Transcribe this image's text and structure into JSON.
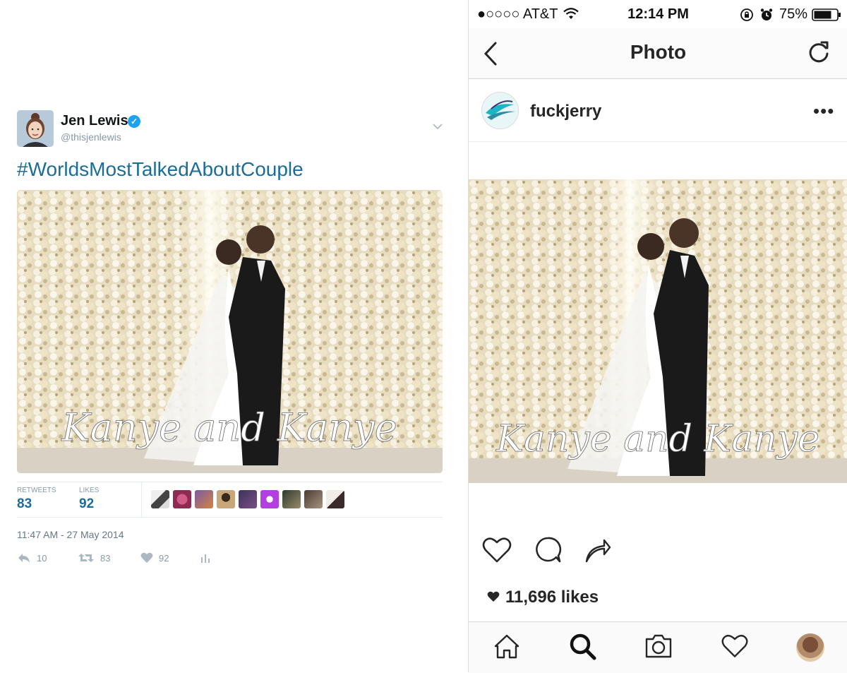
{
  "tweet": {
    "name": "Jen Lewis",
    "handle": "@thisjenlewis",
    "text": "#WorldsMostTalkedAboutCouple",
    "photo_caption": "Kanye and Kanye",
    "stats": {
      "retweets_label": "RETWEETS",
      "retweets_value": "83",
      "likes_label": "LIKES",
      "likes_value": "92"
    },
    "timestamp": "11:47 AM - 27 May 2014",
    "actions": {
      "reply_count": "10",
      "retweet_count": "83",
      "like_count": "92"
    },
    "colors": {
      "link": "#1b6d99",
      "verified": "#1da1f2",
      "muted": "#8899a6"
    }
  },
  "instagram": {
    "status_bar": {
      "carrier": "●○○○○ AT&T",
      "time": "12:14 PM",
      "battery": "75%"
    },
    "nav_title": "Photo",
    "username": "fuckjerry",
    "photo_caption": "Kanye and Kanye",
    "likes": "11,696 likes",
    "icons": [
      "heart-icon",
      "comment-icon",
      "share-icon",
      "home-icon",
      "search-icon",
      "camera-icon",
      "activity-heart-icon",
      "profile-avatar"
    ]
  }
}
